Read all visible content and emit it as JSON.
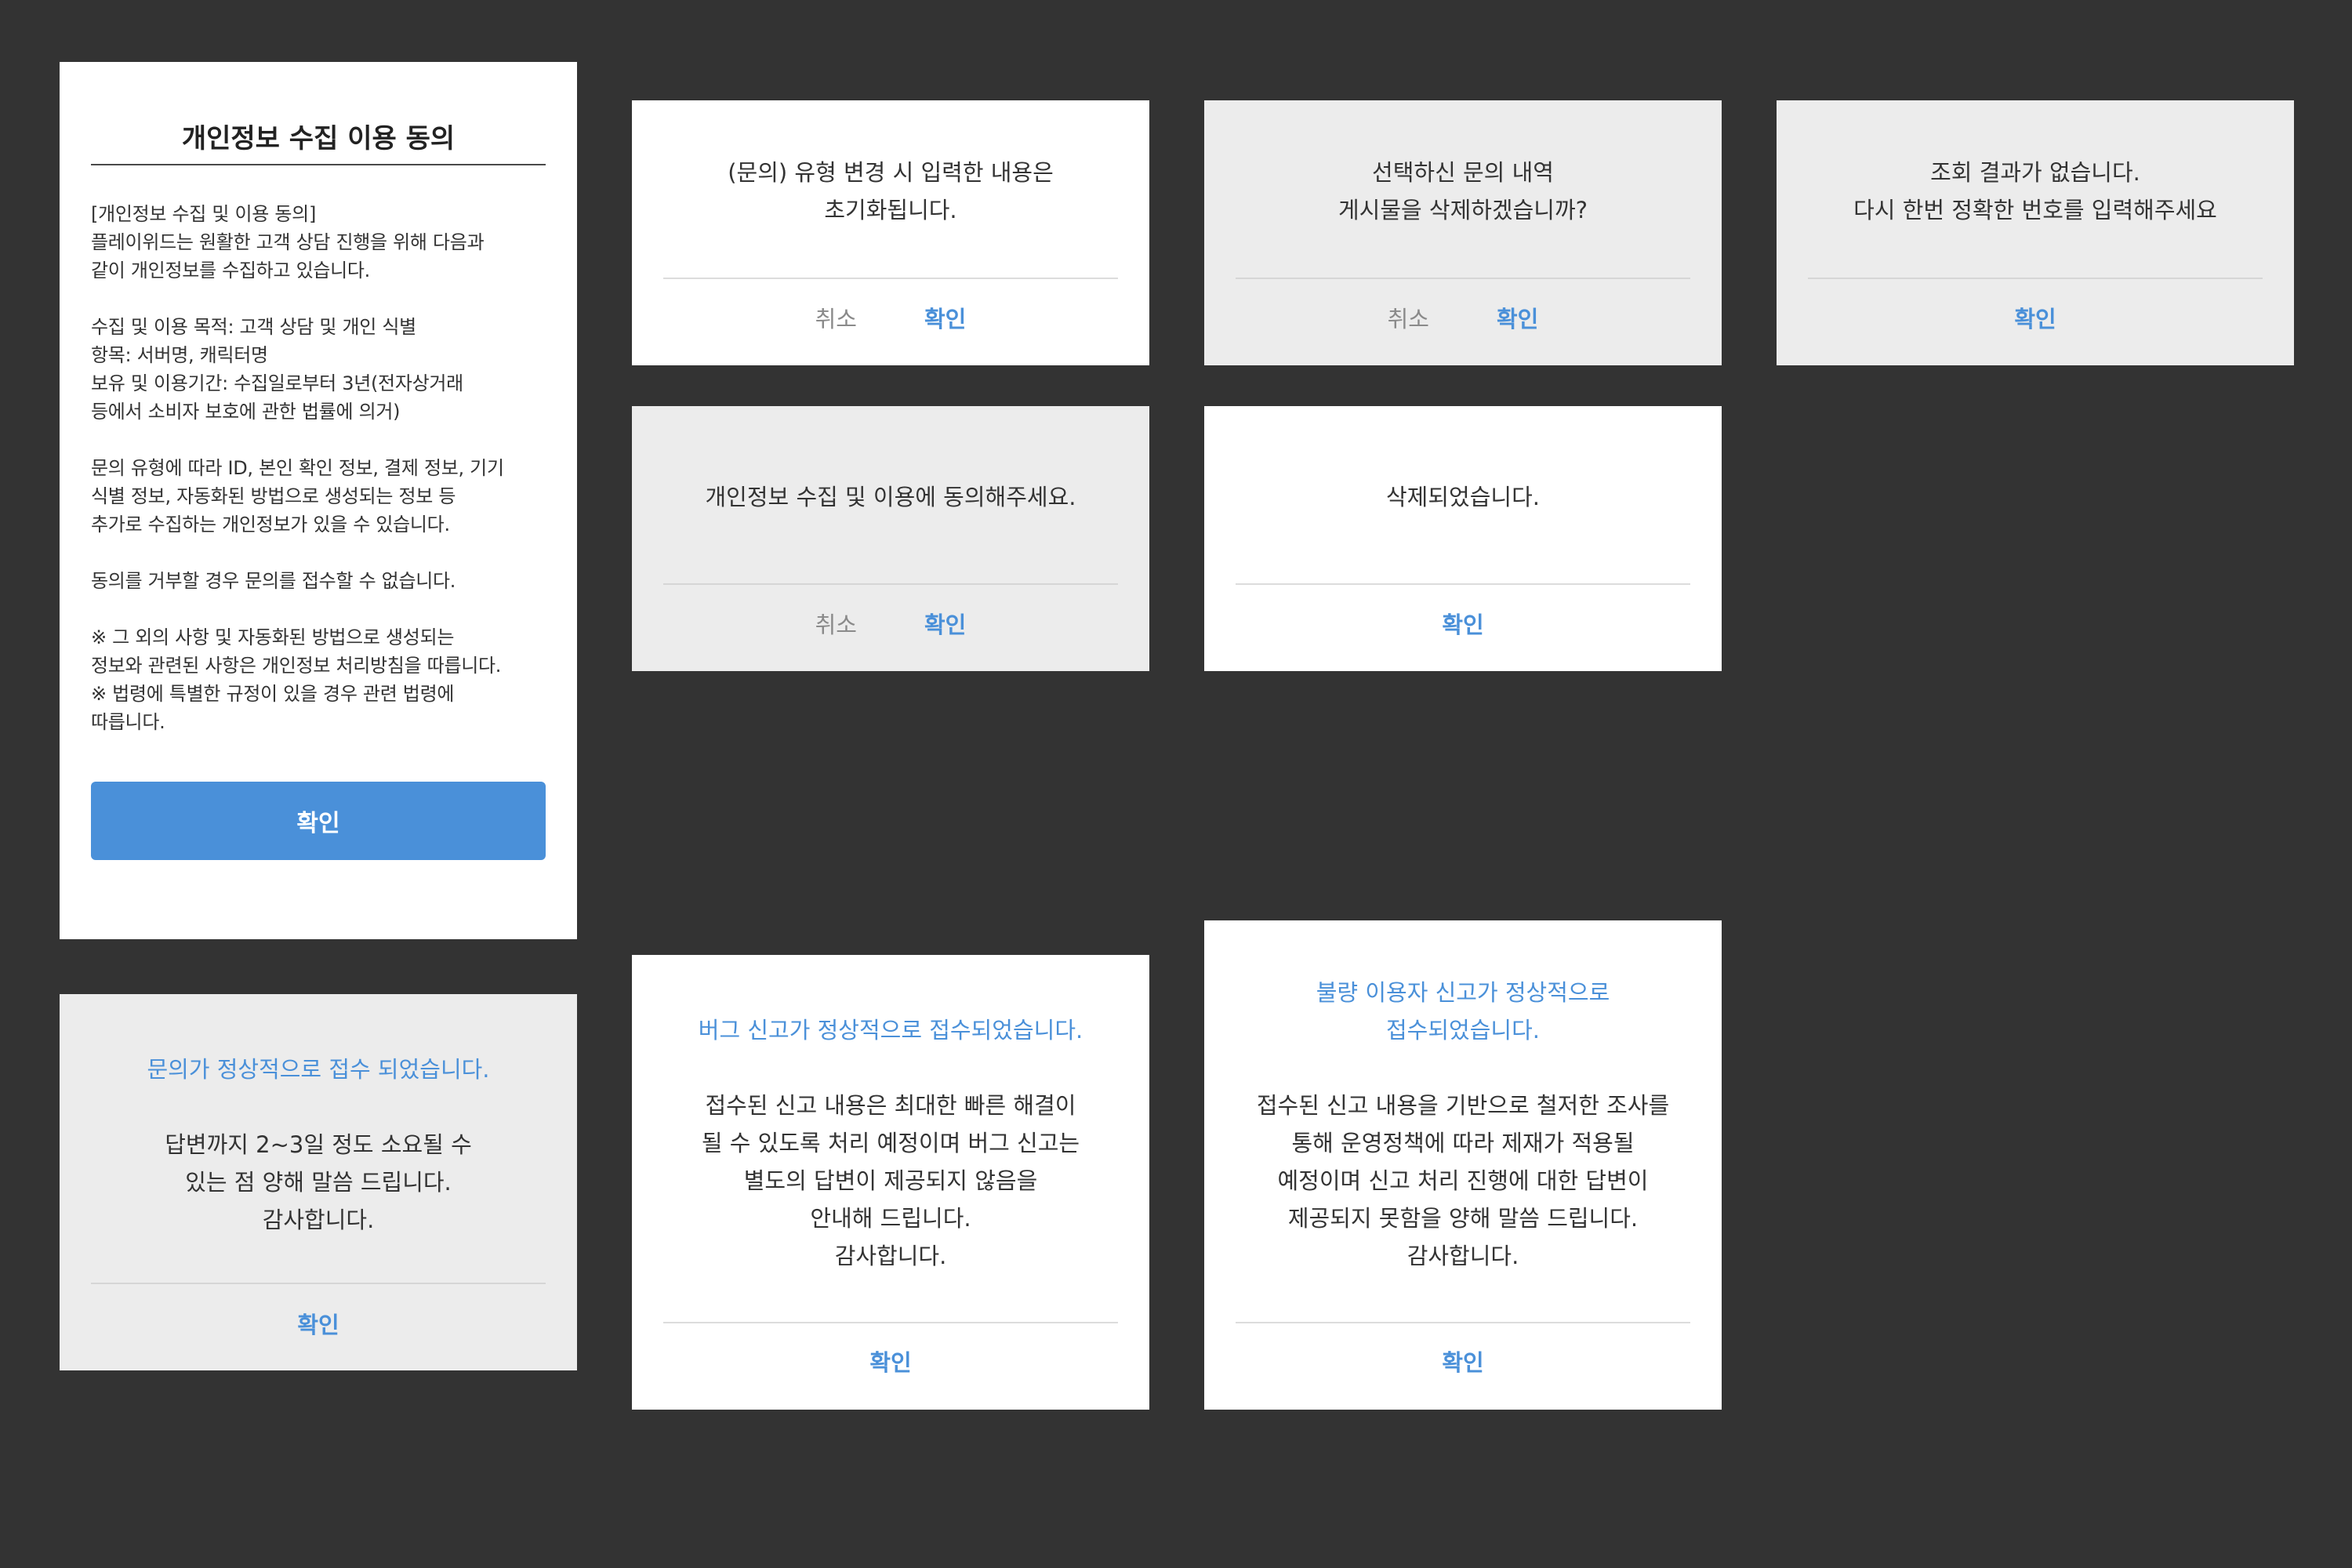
{
  "privacy_dialog": {
    "title": "개인정보 수집 이용 동의",
    "paragraphs": [
      "[개인정보 수집 및 이용 동의]\n플레이위드는 원활한 고객 상담 진행을 위해 다음과\n같이 개인정보를 수집하고 있습니다.",
      "수집 및 이용 목적: 고객 상담 및 개인 식별\n항목: 서버명, 캐릭터명\n보유 및 이용기간: 수집일로부터 3년(전자상거래\n등에서 소비자 보호에 관한 법률에 의거)",
      "문의 유형에 따라 ID, 본인 확인 정보, 결제 정보, 기기\n식별 정보, 자동화된 방법으로 생성되는 정보 등\n추가로 수집하는 개인정보가 있을 수 있습니다.",
      "동의를 거부할 경우 문의를 접수할 수 없습니다.",
      "※ 그 외의 사항 및 자동화된 방법으로 생성되는\n정보와 관련된 사항은 개인정보 처리방침을 따릅니다.\n※ 법령에 특별한 규정이 있을 경우 관련 법령에\n따릅니다."
    ],
    "confirm": "확인"
  },
  "reset_dialog": {
    "message": "(문의) 유형 변경 시 입력한 내용은\n초기화됩니다.",
    "cancel": "취소",
    "confirm": "확인"
  },
  "delete_confirm_dialog": {
    "message": "선택하신 문의 내역\n게시물을 삭제하겠습니까?",
    "cancel": "취소",
    "confirm": "확인"
  },
  "no_result_dialog": {
    "message": "조회 결과가 없습니다.\n다시 한번 정확한 번호를 입력해주세요",
    "confirm": "확인"
  },
  "agree_required_dialog": {
    "message": "개인정보 수집 및 이용에 동의해주세요.",
    "cancel": "취소",
    "confirm": "확인"
  },
  "deleted_dialog": {
    "message": "삭제되었습니다.",
    "confirm": "확인"
  },
  "inquiry_received_dialog": {
    "headline": "문의가 정상적으로 접수 되었습니다.",
    "message": "답변까지 2~3일 정도 소요될 수\n있는 점 양해 말씀 드립니다.\n감사합니다.",
    "confirm": "확인"
  },
  "bug_report_dialog": {
    "headline": "버그 신고가 정상적으로 접수되었습니다.",
    "message": "접수된 신고 내용은 최대한 빠른 해결이\n될 수 있도록 처리 예정이며 버그 신고는\n별도의 답변이 제공되지 않음을\n안내해 드립니다.\n감사합니다.",
    "confirm": "확인"
  },
  "abuse_report_dialog": {
    "headline": "불량 이용자 신고가 정상적으로\n접수되었습니다.",
    "message": "접수된 신고 내용을 기반으로 철저한 조사를\n통해 운영정책에 따라 제재가 적용될\n예정이며 신고 처리 진행에 대한 답변이\n제공되지 못함을 양해 말씀 드립니다.\n감사합니다.",
    "confirm": "확인"
  },
  "colors": {
    "background": "#333333",
    "accent": "#4a90d9",
    "card_white": "#ffffff",
    "card_gray": "#ececec"
  }
}
